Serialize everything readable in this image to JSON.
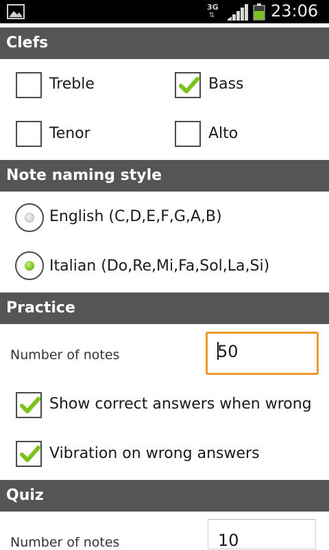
{
  "status_bar": {
    "network": "3G",
    "time": "23:06",
    "colors": {
      "battery": "#7cc21d"
    }
  },
  "sections": {
    "clefs": {
      "title": "Clefs",
      "options": [
        {
          "label": "Treble",
          "checked": false
        },
        {
          "label": "Bass",
          "checked": true
        },
        {
          "label": "Tenor",
          "checked": false
        },
        {
          "label": "Alto",
          "checked": false
        }
      ]
    },
    "note_naming": {
      "title": "Note naming style",
      "options": [
        {
          "label": "English (C,D,E,F,G,A,B)",
          "selected": false
        },
        {
          "label": "Italian (Do,Re,Mi,Fa,Sol,La,Si)",
          "selected": true
        }
      ]
    },
    "practice": {
      "title": "Practice",
      "number_of_notes_label": "Number of notes",
      "number_of_notes_value": "50",
      "options": [
        {
          "label": "Show correct answers when wrong",
          "checked": true
        },
        {
          "label": "Vibration on wrong answers",
          "checked": true
        }
      ]
    },
    "quiz": {
      "title": "Quiz",
      "number_of_notes_label": "Number of notes",
      "number_of_notes_value": "10"
    }
  },
  "colors": {
    "header_bg": "#555555",
    "check_green": "#7cc21d",
    "focus_orange": "#f0962a"
  },
  "icons": [
    "image-notification-icon",
    "network-3g-icon",
    "signal-strength-icon",
    "battery-icon",
    "checkmark-icon"
  ]
}
